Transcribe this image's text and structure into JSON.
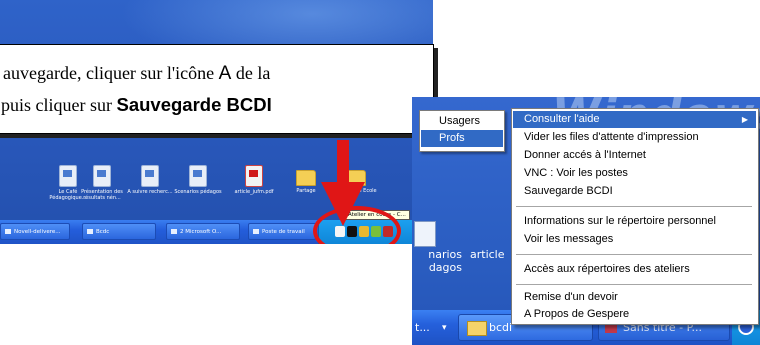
{
  "left_screenshot": {
    "desktop_icons": [
      "Le Café Pédagogique...",
      "Présentation des résultats nén...",
      "A suivre recherc...",
      "Scenarios pédagos",
      "article_jufm.pdf",
      "Partage",
      "Inscription Ecole"
    ],
    "taskbar_buttons": [
      "Novell-delivere...",
      "Bcdc",
      "2 Microsoft O...",
      "Poste de travail"
    ],
    "tray_tooltip": "Atelier en cours - C..."
  },
  "callout": {
    "line1_pre": "auvegarde, cliquer sur l'icône ",
    "line1_letter": "A",
    "line1_post": " de la",
    "line2_pre": "puis cliquer sur ",
    "line2_bold": "Sauvegarde BCDI"
  },
  "right_screenshot": {
    "watermark": "Windows",
    "desktop_label_left": "narios\ndagos",
    "desktop_label_right": "article",
    "taskbar": {
      "btn1": "t...",
      "btn2": "bcdi",
      "btn3": "Sans titre - P..."
    },
    "submenu": {
      "items": [
        {
          "label": "Usagers",
          "selected": false
        },
        {
          "label": "Profs",
          "selected": true
        }
      ]
    },
    "context_menu": {
      "items": [
        {
          "label": "Consulter l'aide",
          "selected": true,
          "has_submenu": true
        },
        {
          "label": "Vider les files d'attente d'impression"
        },
        {
          "label": "Donner accés à l'Internet"
        },
        {
          "label": "VNC : Voir les postes"
        },
        {
          "label": "Sauvegarde BCDI"
        },
        {
          "label": "Informations sur le répertoire personnel"
        },
        {
          "label": "Voir les messages"
        },
        {
          "label": "Accès aux répertoires des ateliers"
        },
        {
          "label": "Remise d'un devoir"
        },
        {
          "label": "A Propos de Gespere"
        }
      ]
    }
  },
  "colors": {
    "desktop_blue": "#2a59bd",
    "taskbar_blue": "#245edc",
    "menu_highlight": "#316ac5",
    "annotation_red": "#e01616"
  }
}
